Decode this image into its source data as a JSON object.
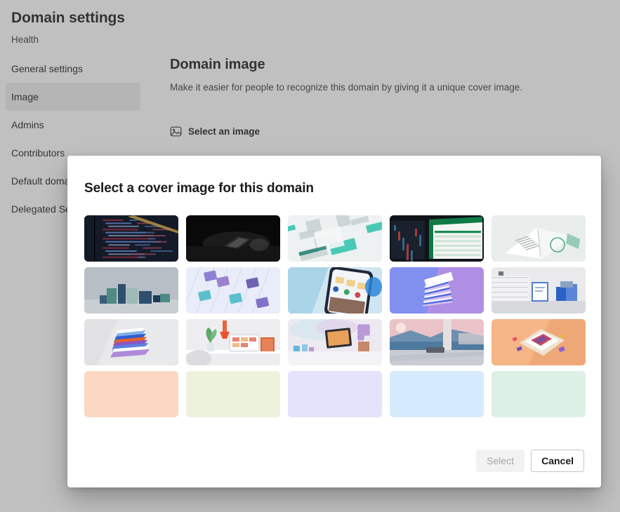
{
  "header": {
    "title": "Domain settings",
    "subtitle": "Health"
  },
  "sidebar": {
    "items": [
      {
        "label": "General settings",
        "selected": false
      },
      {
        "label": "Image",
        "selected": true
      },
      {
        "label": "Admins",
        "selected": false
      },
      {
        "label": "Contributors",
        "selected": false
      },
      {
        "label": "Default domain",
        "selected": false
      },
      {
        "label": "Delegated Settings",
        "selected": false
      }
    ]
  },
  "main": {
    "section_title": "Domain image",
    "section_description": "Make it easier for people to recognize this domain by giving it a unique cover image.",
    "select_image_label": "Select an image",
    "select_image_icon": "image-picture-icon"
  },
  "dialog": {
    "title": "Select a cover image for this domain",
    "select_button": "Select",
    "select_button_disabled": true,
    "cancel_button": "Cancel",
    "selected_thumbnail_index": null,
    "thumbnails": [
      {
        "id": "code-editor-dark",
        "name": "Dark code editor on monitor",
        "kind": "photo",
        "colors": [
          "#151a26",
          "#232b3d",
          "#8d2b3e",
          "#c9a24a"
        ]
      },
      {
        "id": "laptop-dark-desk",
        "name": "Laptop glowing on dark desk",
        "kind": "photo",
        "colors": [
          "#080808",
          "#1c1c1c",
          "#3a3a3a",
          "#d8d8d8"
        ]
      },
      {
        "id": "abstract-teal-circuit",
        "name": "Abstract teal circuit planes",
        "kind": "photo",
        "colors": [
          "#e9eeee",
          "#b9c6c6",
          "#1fbfa6",
          "#0f7a68"
        ]
      },
      {
        "id": "spreadsheet-green-night",
        "name": "Spreadsheet app over night cityscape",
        "kind": "photo",
        "colors": [
          "#121418",
          "#0f6c3f",
          "#1a8a52",
          "#f2f2f2"
        ]
      },
      {
        "id": "notebook-green-desk",
        "name": "Open notebook with green accents",
        "kind": "photo",
        "colors": [
          "#e8eceb",
          "#cfd8d4",
          "#4fae86",
          "#ffffff"
        ]
      },
      {
        "id": "teal-blocks-3d",
        "name": "3D teal and navy blocks",
        "kind": "render",
        "colors": [
          "#b9bfc6",
          "#4f7e7c",
          "#2e4a68",
          "#8fb0ad"
        ]
      },
      {
        "id": "glass-cubes-violet",
        "name": "Glass cubes on grid, violet and teal",
        "kind": "render",
        "colors": [
          "#e6eaf8",
          "#8e6fc6",
          "#3fb8c5",
          "#5a4aa8"
        ]
      },
      {
        "id": "phone-app-blue",
        "name": "Phone with app UI and photo gallery",
        "kind": "render",
        "colors": [
          "#bfe0ef",
          "#2d5fb8",
          "#eef0f4",
          "#f0c24a"
        ]
      },
      {
        "id": "cards-stack-purple",
        "name": "Stacked cards on violet gradient",
        "kind": "render",
        "colors": [
          "#7f8ff0",
          "#b98fe0",
          "#ffffff",
          "#4d6fe0"
        ]
      },
      {
        "id": "office-shelf-blue",
        "name": "Office shelf with blue boxes",
        "kind": "render",
        "colors": [
          "#e9e9ea",
          "#c6c9cd",
          "#2b62c4",
          "#7f93ad"
        ]
      },
      {
        "id": "paper-stack-colorful",
        "name": "Floating stack of colorful papers",
        "kind": "render",
        "colors": [
          "#e6e7e9",
          "#2f5fd0",
          "#e8622a",
          "#8a55c8"
        ]
      },
      {
        "id": "desk-plant-monitor",
        "name": "Desk with plant, lamp and monitor",
        "kind": "render",
        "colors": [
          "#ececee",
          "#e8532e",
          "#5fa86a",
          "#d9d9db"
        ]
      },
      {
        "id": "tablet-lavender-plant",
        "name": "Tablet on shelf with lavender plant",
        "kind": "render",
        "colors": [
          "#ebe8ef",
          "#b79ad6",
          "#8ecbe8",
          "#2b2b33"
        ]
      },
      {
        "id": "pool-dusk-landscape",
        "name": "Pool at dusk with mountain view",
        "kind": "photo",
        "colors": [
          "#e9c3c8",
          "#5a7fa8",
          "#d6dbe2",
          "#3f5a78"
        ]
      },
      {
        "id": "orange-book-isometric",
        "name": "Isometric book on orange background",
        "kind": "render",
        "colors": [
          "#f5b584",
          "#f6c9a5",
          "#c94b5a",
          "#6f4fb0"
        ]
      },
      {
        "id": "solid-peach",
        "name": "Solid peach",
        "kind": "solid",
        "colors": [
          "#fcd8c2"
        ]
      },
      {
        "id": "solid-light-lime",
        "name": "Solid light lime",
        "kind": "solid",
        "colors": [
          "#ecf2dc"
        ]
      },
      {
        "id": "solid-lavender",
        "name": "Solid lavender",
        "kind": "solid",
        "colors": [
          "#e5e3fb"
        ]
      },
      {
        "id": "solid-light-blue",
        "name": "Solid light blue",
        "kind": "solid",
        "colors": [
          "#d6eafd"
        ]
      },
      {
        "id": "solid-mint",
        "name": "Solid mint",
        "kind": "solid",
        "colors": [
          "#ddf0e6"
        ]
      }
    ]
  },
  "colors": {
    "page_background": "#ffffff",
    "overlay": "rgba(90,90,90,0.38)",
    "dialog_background": "#ffffff",
    "nav_selected_background": "#ededed",
    "text_primary": "#1b1b1b",
    "text_secondary": "#3b3b3b",
    "button_disabled_text": "#a7a7a7",
    "button_border": "#c5c5c5"
  }
}
